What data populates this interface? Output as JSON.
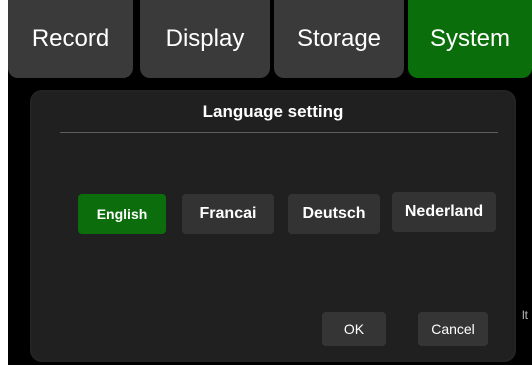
{
  "tabs": [
    {
      "label": "Record",
      "active": false
    },
    {
      "label": "Display",
      "active": false
    },
    {
      "label": "Storage",
      "active": false
    },
    {
      "label": "System",
      "active": true
    }
  ],
  "dialog": {
    "title": "Language setting",
    "languages": [
      {
        "label": "English",
        "selected": true
      },
      {
        "label": "Francai",
        "selected": false
      },
      {
        "label": "Deutsch",
        "selected": false
      },
      {
        "label": "Nederland",
        "selected": false
      }
    ],
    "ok_label": "OK",
    "cancel_label": "Cancel"
  },
  "edge_text": "lt",
  "colors": {
    "active_green": "#0a6e0a",
    "tab_gray": "#3a3a3a",
    "dialog_bg": "#202020",
    "button_gray": "#333333"
  }
}
